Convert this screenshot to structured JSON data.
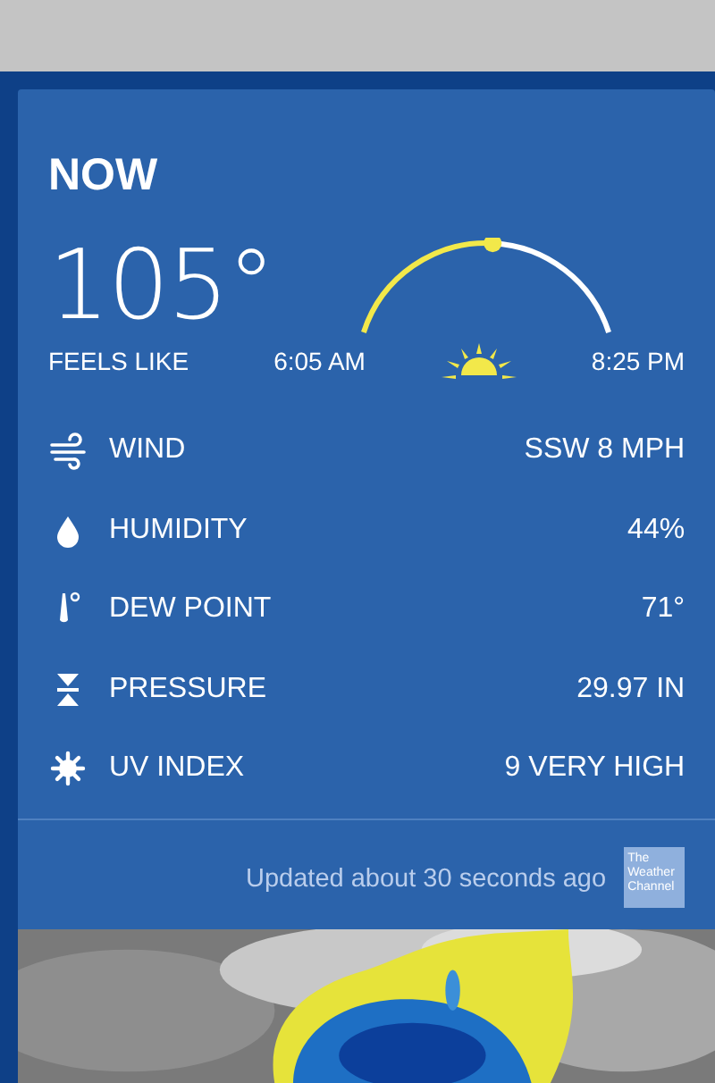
{
  "card": {
    "title": "NOW",
    "temperature": "105°",
    "feels_like": "FEELS LIKE",
    "sun": {
      "sunrise": "6:05 AM",
      "sunset": "8:25 PM"
    },
    "conditions": [
      {
        "kind": "wind",
        "label": "WIND",
        "value": "SSW 8 MPH"
      },
      {
        "kind": "humidity",
        "label": "HUMIDITY",
        "value": "44%"
      },
      {
        "kind": "dew_point",
        "label": "DEW POINT",
        "value": "71°"
      },
      {
        "kind": "pressure",
        "label": "PRESSURE",
        "value": "29.97 IN"
      },
      {
        "kind": "uv",
        "label": "UV INDEX",
        "value": "9 VERY HIGH"
      }
    ],
    "updated": "Updated about 30 seconds ago",
    "logo": "The Weather Channel"
  }
}
